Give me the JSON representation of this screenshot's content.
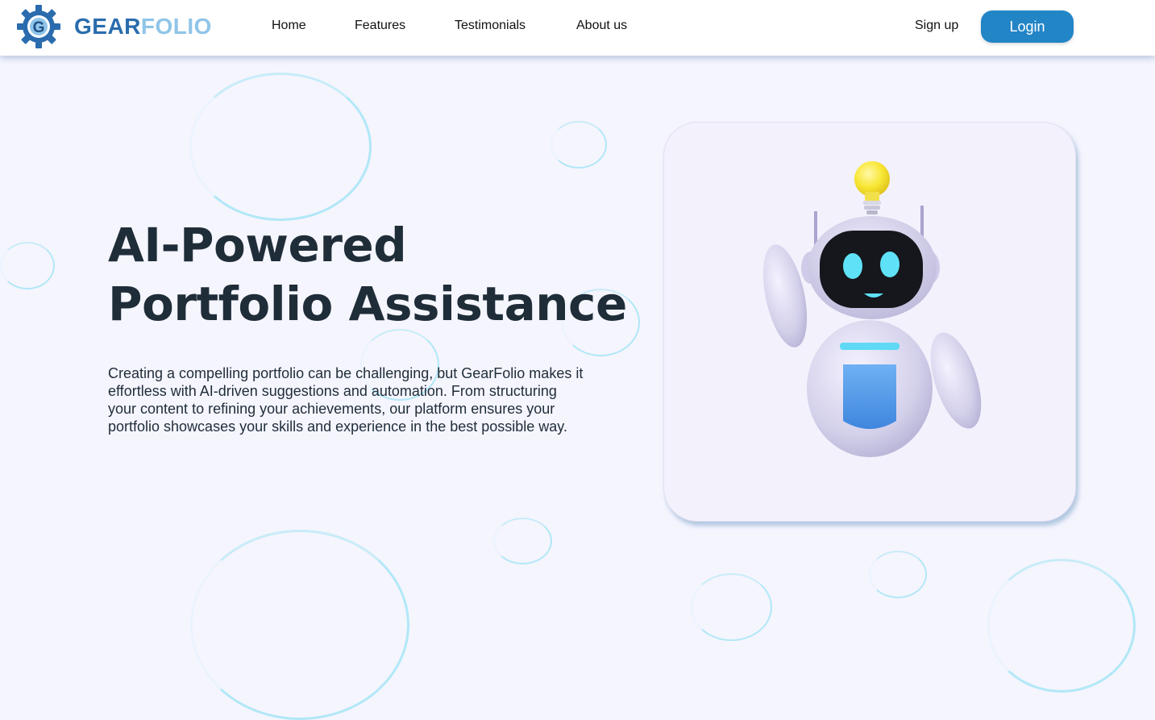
{
  "brand": {
    "logo_word_1": "GEAR",
    "logo_word_2": "FOLIO",
    "logo_letter": "G",
    "primary_color": "#2a6cae",
    "secondary_color": "#8fc5e8"
  },
  "nav": {
    "items": [
      {
        "label": "Home"
      },
      {
        "label": "Features"
      },
      {
        "label": "Testimonials"
      },
      {
        "label": "About us"
      }
    ],
    "signup_label": "Sign up",
    "login_label": "Login",
    "login_color": "#2285c6"
  },
  "hero": {
    "title_line_1": "AI-Powered",
    "title_line_2": "Portfolio Assistance",
    "description": "Creating a compelling portfolio can be challenging, but GearFolio makes it effortless with AI-driven suggestions and automation. From structuring your content to refining your achievements, our platform ensures your portfolio showcases your skills and experience in the best possible way."
  },
  "illustration": {
    "icon": "robot-with-lightbulb-icon"
  }
}
